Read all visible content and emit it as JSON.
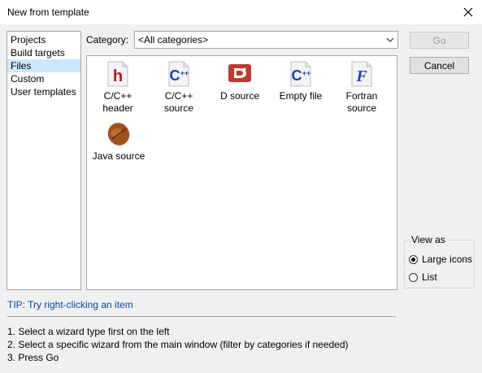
{
  "window": {
    "title": "New from template"
  },
  "sidebar": {
    "items": [
      {
        "label": "Projects",
        "selected": false
      },
      {
        "label": "Build targets",
        "selected": false
      },
      {
        "label": "Files",
        "selected": true
      },
      {
        "label": "Custom",
        "selected": false
      },
      {
        "label": "User templates",
        "selected": false
      }
    ]
  },
  "category": {
    "label": "Category:",
    "value": "<All categories>"
  },
  "templates": [
    {
      "line1": "C/C++",
      "line2": "header",
      "icon": "c-header-icon"
    },
    {
      "line1": "C/C++",
      "line2": "source",
      "icon": "cpp-source-icon"
    },
    {
      "line1": "D source",
      "line2": "",
      "icon": "d-source-icon"
    },
    {
      "line1": "Empty file",
      "line2": "",
      "icon": "empty-file-icon"
    },
    {
      "line1": "Fortran",
      "line2": "source",
      "icon": "fortran-source-icon"
    },
    {
      "line1": "Java source",
      "line2": "",
      "icon": "java-source-icon"
    }
  ],
  "buttons": {
    "go": "Go",
    "cancel": "Cancel"
  },
  "view_as": {
    "label": "View as",
    "options": [
      {
        "label": "Large icons",
        "checked": true
      },
      {
        "label": "List",
        "checked": false
      }
    ]
  },
  "tip": "TIP: Try right-clicking an item",
  "instructions": [
    "1. Select a wizard type first on the left",
    "2. Select a specific wizard from the main window (filter by categories if needed)",
    "3. Press Go"
  ],
  "colors": {
    "selection": "#cce8ff",
    "tip_text": "#0645ad"
  }
}
